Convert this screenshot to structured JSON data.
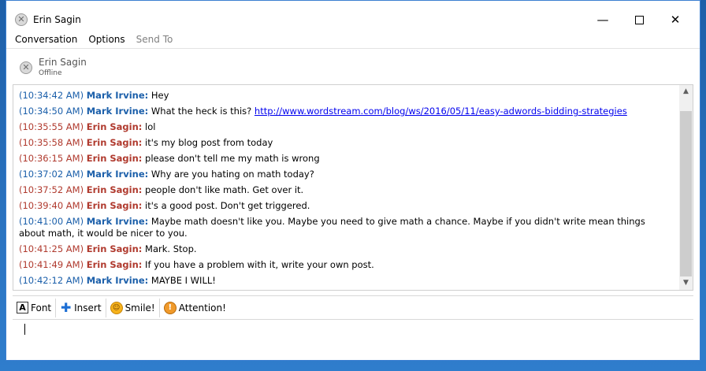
{
  "window": {
    "title": "Erin Sagin",
    "minimize_glyph": "—",
    "close_glyph": "✕"
  },
  "menu": [
    {
      "label": "Conversation",
      "enabled": true
    },
    {
      "label": "Options",
      "enabled": true
    },
    {
      "label": "Send To",
      "enabled": false
    }
  ],
  "contact": {
    "name": "Erin Sagin",
    "status": "Offline",
    "icon": "offline-status-icon"
  },
  "messages": [
    {
      "time": "(10:34:42 AM)",
      "sender": "Mark Irvine:",
      "text": " Hey",
      "who": "blue"
    },
    {
      "time": "(10:34:50 AM)",
      "sender": "Mark Irvine:",
      "text": " What the heck is this? ",
      "link": "http://www.wordstream.com/blog/ws/2016/05/11/easy-adwords-bidding-strategies",
      "who": "blue"
    },
    {
      "time": "(10:35:55 AM)",
      "sender": "Erin Sagin:",
      "text": " lol",
      "who": "red"
    },
    {
      "time": "(10:35:58 AM)",
      "sender": "Erin Sagin:",
      "text": " it's my blog post from today",
      "who": "red"
    },
    {
      "time": "(10:36:15 AM)",
      "sender": "Erin Sagin:",
      "text": " please don't tell me my math is wrong",
      "who": "red"
    },
    {
      "time": "(10:37:02 AM)",
      "sender": "Mark Irvine:",
      "text": "  Why are you hating on math today?",
      "who": "blue"
    },
    {
      "time": "(10:37:52 AM)",
      "sender": "Erin Sagin:",
      "text": " people don't like math. Get over it.",
      "who": "red"
    },
    {
      "time": "(10:39:40 AM)",
      "sender": "Erin Sagin:",
      "text": " it's a good post. Don't get triggered.",
      "who": "red"
    },
    {
      "time": "(10:41:00 AM)",
      "sender": "Mark Irvine:",
      "text": " Maybe math doesn't like you. Maybe you need to give math a chance. Maybe if you didn't write mean things about math, it would be nicer to you.",
      "who": "blue"
    },
    {
      "time": "(10:41:25 AM)",
      "sender": "Erin Sagin:",
      "text": " Mark. Stop.",
      "who": "red"
    },
    {
      "time": "(10:41:49 AM)",
      "sender": "Erin Sagin:",
      "text": " If you have a problem with it, write your own post.",
      "who": "red"
    },
    {
      "time": "(10:42:12 AM)",
      "sender": "Mark Irvine:",
      "text": " MAYBE I WILL!",
      "who": "blue"
    }
  ],
  "toolbar": {
    "font_label": "Font",
    "insert_label": "Insert",
    "smile_label": "Smile!",
    "attention_label": "Attention!",
    "font_icon_glyph": "A",
    "insert_icon_glyph": "✚",
    "smile_icon_glyph": "☺",
    "attention_icon_glyph": "!"
  },
  "input": {
    "value": ""
  },
  "colors": {
    "mark_color": "#1b5faa",
    "erin_color": "#b03a2e",
    "link_color": "#0000ee"
  }
}
